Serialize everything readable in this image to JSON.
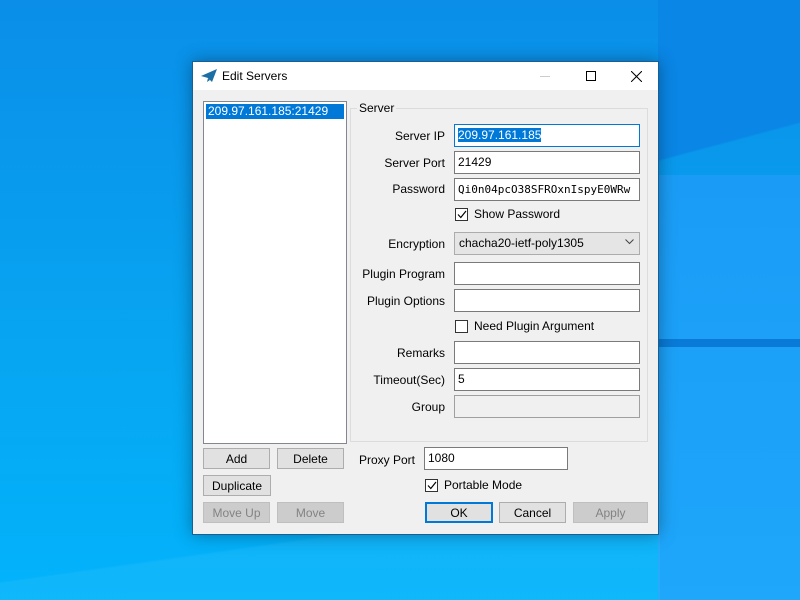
{
  "window": {
    "title": "Edit Servers",
    "controls": {
      "minimize": "minimize",
      "maximize": "maximize",
      "close": "close"
    }
  },
  "server_list": {
    "items": [
      {
        "label": "209.97.161.185:21429",
        "selected": true
      }
    ]
  },
  "list_buttons": {
    "add": "Add",
    "delete": "Delete",
    "duplicate": "Duplicate",
    "move_up": "Move Up",
    "move_down": "Move"
  },
  "server_group": {
    "title": "Server",
    "server_ip": {
      "label": "Server IP",
      "value": "209.97.161.185"
    },
    "server_port": {
      "label": "Server Port",
      "value": "21429"
    },
    "password": {
      "label": "Password",
      "value": "Qi0n04pcO38SFROxnIspyE0WRw"
    },
    "show_password": {
      "label": "Show Password",
      "checked": true
    },
    "encryption": {
      "label": "Encryption",
      "value": "chacha20-ietf-poly1305"
    },
    "plugin_program": {
      "label": "Plugin Program",
      "value": ""
    },
    "plugin_options": {
      "label": "Plugin Options",
      "value": ""
    },
    "need_plugin_argument": {
      "label": "Need Plugin Argument",
      "checked": false
    },
    "remarks": {
      "label": "Remarks",
      "value": ""
    },
    "timeout": {
      "label": "Timeout(Sec)",
      "value": "5"
    },
    "group": {
      "label": "Group",
      "value": ""
    }
  },
  "proxy_port": {
    "label": "Proxy Port",
    "value": "1080"
  },
  "portable_mode": {
    "label": "Portable Mode",
    "checked": true
  },
  "dialog_buttons": {
    "ok": "OK",
    "cancel": "Cancel",
    "apply": "Apply"
  },
  "colors": {
    "accent": "#0078d7",
    "window_bg": "#f0f0f0",
    "desktop": "#0a8ee8"
  }
}
